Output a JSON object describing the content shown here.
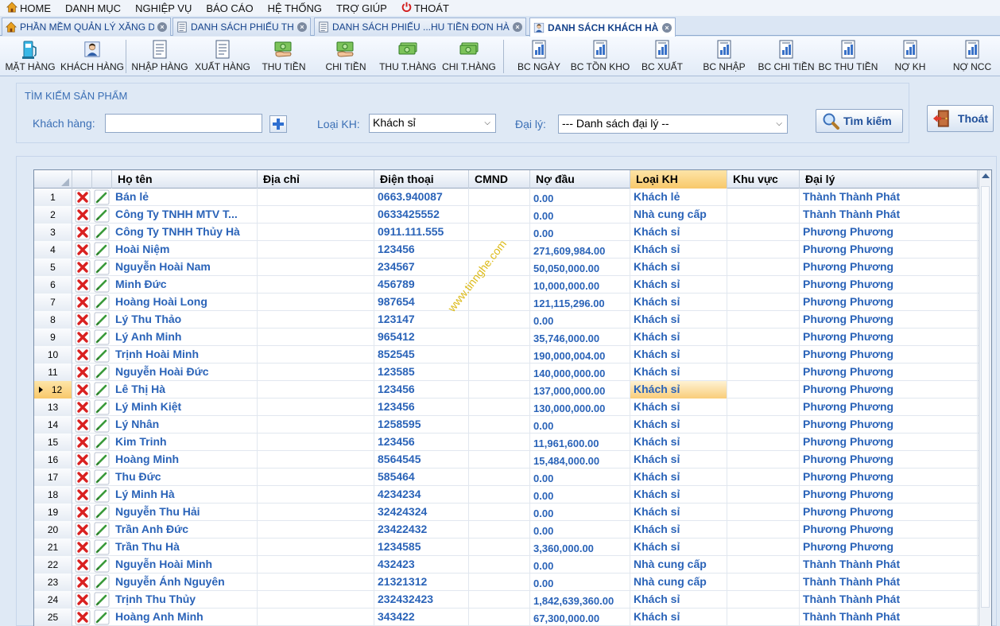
{
  "menu": [
    {
      "label": "HOME",
      "icon": "home-icon"
    },
    {
      "label": "DANH MỤC"
    },
    {
      "label": "NGHIỆP VỤ"
    },
    {
      "label": "BÁO CÁO"
    },
    {
      "label": "HỆ THỐNG"
    },
    {
      "label": "TRỢ GIÚP"
    },
    {
      "label": "THOÁT",
      "icon": "power-icon"
    }
  ],
  "tabs": [
    {
      "label": "PHẦN MỀM QUẢN LÝ XĂNG DẦU",
      "icon": "home-icon",
      "active": false
    },
    {
      "label": "DANH SÁCH PHIẾU THU",
      "icon": "list-icon",
      "active": false
    },
    {
      "label": "DANH SÁCH PHIẾU ...HU TIỀN ĐƠN HÀNG",
      "icon": "list-icon",
      "active": false
    },
    {
      "label": "DANH SÁCH KHÁCH HÀNG",
      "icon": "customer-icon",
      "active": true
    }
  ],
  "toolbar": [
    {
      "label": "MẶT HÀNG",
      "icon": "gas-pump-icon"
    },
    {
      "label": "KHÁCH HÀNG",
      "icon": "customer-icon"
    },
    {
      "label": "NHẬP HÀNG",
      "icon": "document-icon"
    },
    {
      "label": "XUẤT HÀNG",
      "icon": "document-icon"
    },
    {
      "label": "THU TIỀN",
      "icon": "money-hand-icon"
    },
    {
      "label": "CHI TIỀN",
      "icon": "money-hand-icon"
    },
    {
      "label": "THU T.HÀNG",
      "icon": "money-icon"
    },
    {
      "label": "CHI T.HÀNG",
      "icon": "money-icon"
    },
    {
      "label": "BC NGÀY",
      "icon": "report-icon"
    },
    {
      "label": "BC TỒN KHO",
      "icon": "report-icon"
    },
    {
      "label": "BC XUẤT",
      "icon": "report-icon"
    },
    {
      "label": "BC NHẬP",
      "icon": "report-icon"
    },
    {
      "label": "BC CHI TIỀN",
      "icon": "report-icon"
    },
    {
      "label": "BC THU TIỀN",
      "icon": "report-icon"
    },
    {
      "label": "NỢ KH",
      "icon": "report-icon"
    },
    {
      "label": "NỢ NCC",
      "icon": "report-icon"
    }
  ],
  "search": {
    "title": "TÌM KIẾM SẢN PHẨM",
    "customer_label": "Khách hàng:",
    "customer_value": "",
    "type_label": "Loại KH:",
    "type_value": "Khách sỉ",
    "agent_label": "Đại lý:",
    "agent_value": "--- Danh sách đại lý --",
    "search_button": "Tìm kiếm",
    "exit_button": "Thoát"
  },
  "grid": {
    "columns": [
      "Họ tên",
      "Địa chỉ",
      "Điện thoại",
      "CMND",
      "Nợ đầu",
      "Loại KH",
      "Khu vực",
      "Đại lý"
    ],
    "selected_column": "Loại KH",
    "current_row": 12,
    "rows": [
      {
        "no": "1",
        "name": "Bán lẻ",
        "address": "",
        "phone": "0663.940087",
        "cmnd": "",
        "debt": "0.00",
        "type": "Khách lẻ",
        "area": "",
        "agent": "Thành  Thành Phát"
      },
      {
        "no": "2",
        "name": "Công Ty TNHH MTV T...",
        "address": "",
        "phone": "0633425552",
        "cmnd": "",
        "debt": "0.00",
        "type": "Nhà cung cấp",
        "area": "",
        "agent": "Thành  Thành Phát"
      },
      {
        "no": "3",
        "name": "Công Ty TNHH Thủy Hà",
        "address": "",
        "phone": "0911.111.555",
        "cmnd": "",
        "debt": "0.00",
        "type": "Khách sỉ",
        "area": "",
        "agent": "Phương Phương"
      },
      {
        "no": "4",
        "name": "Hoài Niệm",
        "address": "",
        "phone": "123456",
        "cmnd": "",
        "debt": "271,609,984.00",
        "type": "Khách sỉ",
        "area": "",
        "agent": "Phương Phương"
      },
      {
        "no": "5",
        "name": "Nguyễn Hoài Nam",
        "address": "",
        "phone": "234567",
        "cmnd": "",
        "debt": "50,050,000.00",
        "type": "Khách sỉ",
        "area": "",
        "agent": "Phương Phương"
      },
      {
        "no": "6",
        "name": "Minh Đức",
        "address": "",
        "phone": "456789",
        "cmnd": "",
        "debt": "10,000,000.00",
        "type": "Khách sỉ",
        "area": "",
        "agent": "Phương Phương"
      },
      {
        "no": "7",
        "name": "Hoàng Hoài Long",
        "address": "",
        "phone": "987654",
        "cmnd": "",
        "debt": "121,115,296.00",
        "type": "Khách sỉ",
        "area": "",
        "agent": "Phương Phương"
      },
      {
        "no": "8",
        "name": "Lý Thu Thảo",
        "address": "",
        "phone": "123147",
        "cmnd": "",
        "debt": "0.00",
        "type": "Khách sỉ",
        "area": "",
        "agent": "Phương Phương"
      },
      {
        "no": "9",
        "name": "Lý Anh Minh",
        "address": "",
        "phone": "965412",
        "cmnd": "",
        "debt": "35,746,000.00",
        "type": "Khách sỉ",
        "area": "",
        "agent": "Phương Phương"
      },
      {
        "no": "10",
        "name": "Trịnh Hoài Minh",
        "address": "",
        "phone": "852545",
        "cmnd": "",
        "debt": "190,000,004.00",
        "type": "Khách sỉ",
        "area": "",
        "agent": "Phương Phương"
      },
      {
        "no": "11",
        "name": "Nguyễn Hoài Đức",
        "address": "",
        "phone": "123585",
        "cmnd": "",
        "debt": "140,000,000.00",
        "type": "Khách sỉ",
        "area": "",
        "agent": "Phương Phương"
      },
      {
        "no": "12",
        "name": "Lê Thị Hà",
        "address": "",
        "phone": "123456",
        "cmnd": "",
        "debt": "137,000,000.00",
        "type": "Khách sỉ",
        "area": "",
        "agent": "Phương Phương"
      },
      {
        "no": "13",
        "name": "Lý Minh Kiệt",
        "address": "",
        "phone": "123456",
        "cmnd": "",
        "debt": "130,000,000.00",
        "type": "Khách sỉ",
        "area": "",
        "agent": "Phương Phương"
      },
      {
        "no": "14",
        "name": "Lý Nhân",
        "address": "",
        "phone": "1258595",
        "cmnd": "",
        "debt": "0.00",
        "type": "Khách sỉ",
        "area": "",
        "agent": "Phương Phương"
      },
      {
        "no": "15",
        "name": "Kim Trinh",
        "address": "",
        "phone": "123456",
        "cmnd": "",
        "debt": "11,961,600.00",
        "type": "Khách sỉ",
        "area": "",
        "agent": "Phương Phương"
      },
      {
        "no": "16",
        "name": "Hoàng Minh",
        "address": "",
        "phone": "8564545",
        "cmnd": "",
        "debt": "15,484,000.00",
        "type": "Khách sỉ",
        "area": "",
        "agent": "Phương Phương"
      },
      {
        "no": "17",
        "name": "Thu Đức",
        "address": "",
        "phone": "585464",
        "cmnd": "",
        "debt": "0.00",
        "type": "Khách sỉ",
        "area": "",
        "agent": "Phương Phương"
      },
      {
        "no": "18",
        "name": "Lý Minh Hà",
        "address": "",
        "phone": "4234234",
        "cmnd": "",
        "debt": "0.00",
        "type": "Khách sỉ",
        "area": "",
        "agent": "Phương Phương"
      },
      {
        "no": "19",
        "name": "Nguyễn Thu Hải",
        "address": "",
        "phone": "32424324",
        "cmnd": "",
        "debt": "0.00",
        "type": "Khách sỉ",
        "area": "",
        "agent": "Phương Phương"
      },
      {
        "no": "20",
        "name": "Trần Anh Đức",
        "address": "",
        "phone": "23422432",
        "cmnd": "",
        "debt": "0.00",
        "type": "Khách sỉ",
        "area": "",
        "agent": "Phương Phương"
      },
      {
        "no": "21",
        "name": "Trần Thu Hà",
        "address": "",
        "phone": "1234585",
        "cmnd": "",
        "debt": "3,360,000.00",
        "type": "Khách sỉ",
        "area": "",
        "agent": "Phương Phương"
      },
      {
        "no": "22",
        "name": "Nguyễn Hoài Minh",
        "address": "",
        "phone": "432423",
        "cmnd": "",
        "debt": "0.00",
        "type": "Nhà cung cấp",
        "area": "",
        "agent": "Thành  Thành Phát"
      },
      {
        "no": "23",
        "name": "Nguyễn Ánh Nguyên",
        "address": "",
        "phone": "21321312",
        "cmnd": "",
        "debt": "0.00",
        "type": "Nhà cung cấp",
        "area": "",
        "agent": "Thành  Thành Phát"
      },
      {
        "no": "24",
        "name": "Trịnh Thu Thủy",
        "address": "",
        "phone": "232432423",
        "cmnd": "",
        "debt": "1,842,639,360.00",
        "type": "Khách sỉ",
        "area": "",
        "agent": "Thành  Thành Phát"
      },
      {
        "no": "25",
        "name": "Hoàng Anh Minh",
        "address": "",
        "phone": "343422",
        "cmnd": "",
        "debt": "67,300,000.00",
        "type": "Khách sỉ",
        "area": "",
        "agent": "Thành  Thành Phát"
      }
    ]
  },
  "watermark": "www.tinnghe.com",
  "colors": {
    "accent": "#2a63b8",
    "label": "#3b6fb5",
    "highlight": "#f8c86a",
    "delete": "#d92020",
    "edit": "#3a9a3a"
  }
}
